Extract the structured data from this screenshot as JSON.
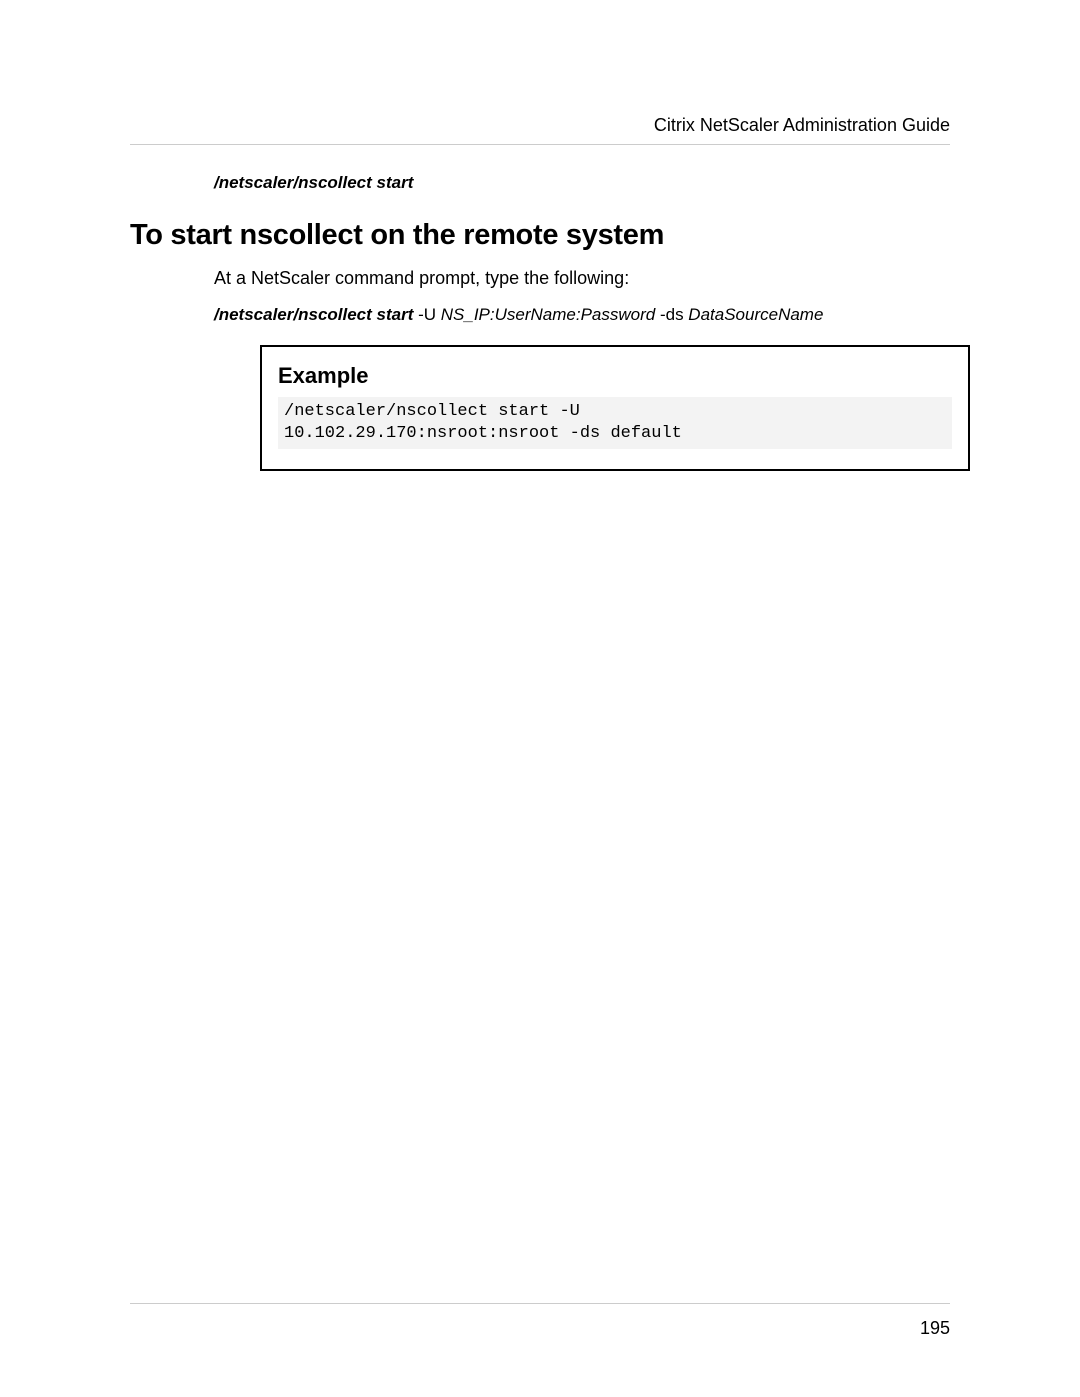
{
  "header": {
    "title": "Citrix NetScaler Administration Guide"
  },
  "content": {
    "first_command": "/netscaler/nscollect start",
    "section_heading": "To start nscollect on the remote system",
    "intro_text": "At a NetScaler command prompt, type the following:",
    "syntax": {
      "cmd": "/netscaler/nscollect start",
      "flag1": " -U ",
      "arg1": "NS_IP:UserName:Password",
      "flag2": "  -ds ",
      "arg2": "DataSourceName"
    },
    "example": {
      "heading": "Example",
      "code": "/netscaler/nscollect start -U\n10.102.29.170:nsroot:nsroot -ds default"
    }
  },
  "footer": {
    "page_number": "195"
  }
}
